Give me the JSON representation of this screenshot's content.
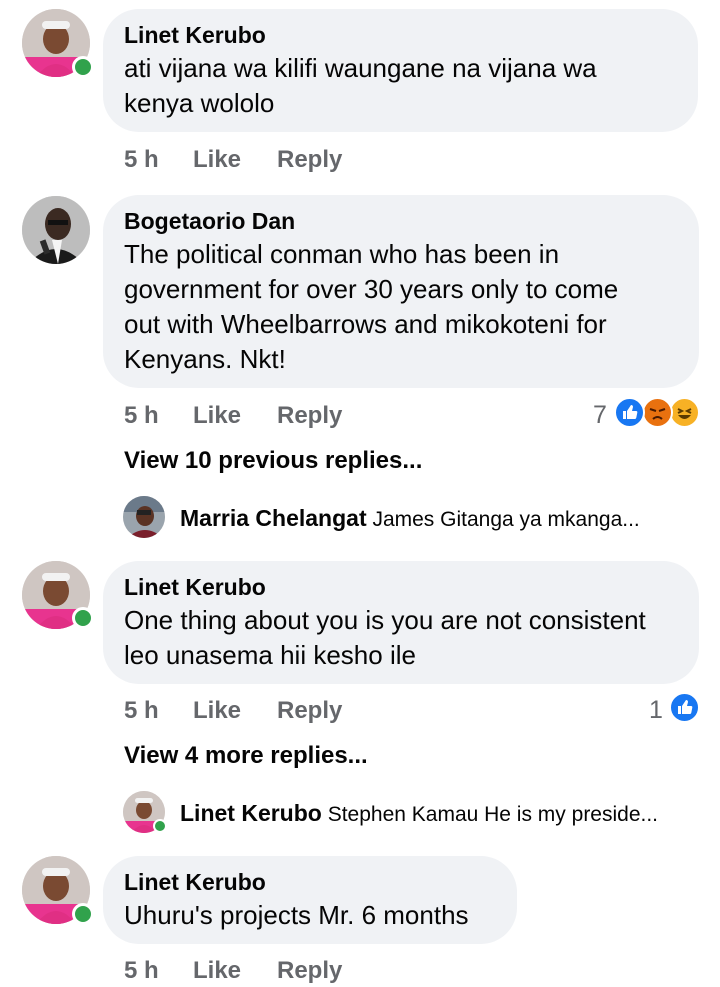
{
  "colors": {
    "like_blue": "#1877f2",
    "angry_orange": "#e9710f",
    "haha_yellow": "#f7b125",
    "online_green": "#31a24c",
    "bubble_bg": "#f0f2f5",
    "meta_gray": "#65676b"
  },
  "comments": [
    {
      "author": "Linet Kerubo",
      "text_lines": [
        "ati vijana wa kilifi waungane na vijana wa",
        "kenya wololo"
      ],
      "time": "5 h",
      "like_label": "Like",
      "reply_label": "Reply"
    },
    {
      "author": "Bogetaorio Dan",
      "text_lines": [
        "The political conman who has been in",
        "government for over 30 years only to come",
        "out with Wheelbarrows and mikokoteni for",
        "Kenyans. Nkt!"
      ],
      "time": "5 h",
      "like_label": "Like",
      "reply_label": "Reply",
      "reaction_count": "7",
      "reactions": [
        "like-icon",
        "angry-icon",
        "haha-icon"
      ],
      "view_replies": "View 10 previous replies...",
      "reply_preview": {
        "author": "Marria Chelangat",
        "text": "James Gitanga ya mkanga..."
      }
    },
    {
      "author": "Linet Kerubo",
      "text_lines": [
        "One thing about you is you are not consistent",
        "leo unasema hii kesho ile"
      ],
      "time": "5 h",
      "like_label": "Like",
      "reply_label": "Reply",
      "reaction_count": "1",
      "reactions": [
        "like-icon"
      ],
      "view_replies": "View 4 more replies...",
      "reply_preview": {
        "author": "Linet Kerubo",
        "text": "Stephen Kamau He is my preside..."
      }
    },
    {
      "author": "Linet Kerubo",
      "text_lines": [
        "Uhuru's projects Mr. 6 months"
      ],
      "time": "5 h",
      "like_label": "Like",
      "reply_label": "Reply"
    }
  ]
}
